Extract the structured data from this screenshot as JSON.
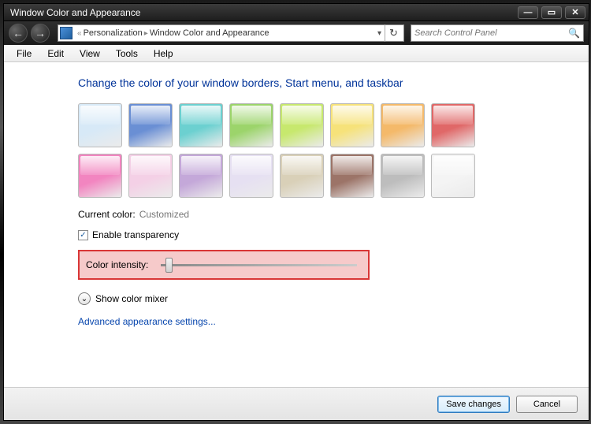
{
  "window": {
    "title": "Window Color and Appearance"
  },
  "titlebar_buttons": {
    "min": "—",
    "max": "▭",
    "close": "✕"
  },
  "nav": {
    "back_glyph": "←",
    "forward_glyph": "→"
  },
  "address": {
    "chevrons": "«",
    "crumb1": "Personalization",
    "sep": "▸",
    "crumb2": "Window Color and Appearance",
    "dropdown_glyph": "▾",
    "refresh_glyph": "↻"
  },
  "search": {
    "placeholder": "Search Control Panel",
    "icon": "🔍"
  },
  "menu": [
    "File",
    "Edit",
    "View",
    "Tools",
    "Help"
  ],
  "heading": "Change the color of your window borders, Start menu, and taskbar",
  "swatches": [
    {
      "name": "sky",
      "color": "#d7e9f7"
    },
    {
      "name": "twilight",
      "color": "#6a8fd4"
    },
    {
      "name": "sea",
      "color": "#6cd0d0"
    },
    {
      "name": "leaf",
      "color": "#9cd46b"
    },
    {
      "name": "lime",
      "color": "#c7e86e"
    },
    {
      "name": "sun",
      "color": "#f6e27a"
    },
    {
      "name": "pumpkin",
      "color": "#f4b96a"
    },
    {
      "name": "ruby",
      "color": "#e06868"
    },
    {
      "name": "fuchsia",
      "color": "#f285c0"
    },
    {
      "name": "blush",
      "color": "#f4d0e6"
    },
    {
      "name": "violet",
      "color": "#c4a8d9"
    },
    {
      "name": "lavender",
      "color": "#e6e0f2"
    },
    {
      "name": "taupe",
      "color": "#d9d0b8"
    },
    {
      "name": "chocolate",
      "color": "#9c7468"
    },
    {
      "name": "slate",
      "color": "#bdbdbd"
    },
    {
      "name": "frost",
      "color": "#f4f4f4"
    }
  ],
  "current_color_label": "Current color:",
  "current_color_value": "Customized",
  "transparency": {
    "label": "Enable transparency",
    "checked": "✓"
  },
  "intensity_label": "Color intensity:",
  "mixer": {
    "glyph": "⌄",
    "label": "Show color mixer"
  },
  "advanced_link": "Advanced appearance settings...",
  "footer": {
    "save": "Save changes",
    "cancel": "Cancel"
  }
}
